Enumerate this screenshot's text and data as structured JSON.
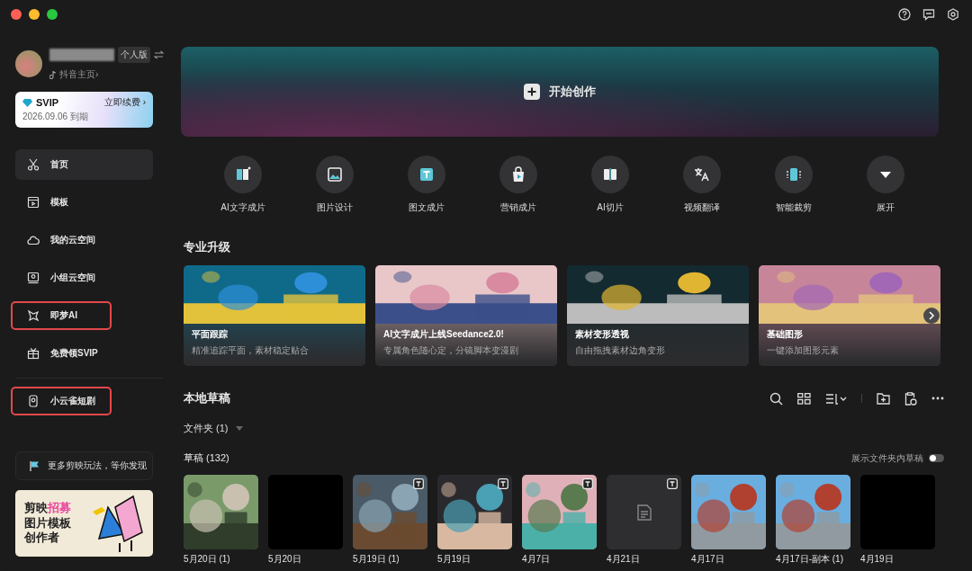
{
  "account": {
    "edition": "个人版",
    "profile_link": "抖音主页›"
  },
  "vip": {
    "badge": "SVIP",
    "renew": "立即续费 ›",
    "expiry": "2026.09.06 到期"
  },
  "nav": [
    {
      "label": "首页",
      "selected": true,
      "highlighted": false
    },
    {
      "label": "模板",
      "selected": false,
      "highlighted": false
    },
    {
      "label": "我的云空间",
      "selected": false,
      "highlighted": false
    },
    {
      "label": "小组云空间",
      "selected": false,
      "highlighted": false
    },
    {
      "label": "即梦AI",
      "selected": false,
      "highlighted": true
    },
    {
      "label": "免费领SVIP",
      "selected": false,
      "highlighted": false
    },
    {
      "label": "小云雀短剧",
      "selected": false,
      "highlighted": true
    }
  ],
  "discover": "更多剪映玩法，等你发现",
  "promo": {
    "line1a": "剪映",
    "line1b": "招募",
    "line2": "图片模板",
    "line3": "创作者"
  },
  "hero": {
    "label": "开始创作"
  },
  "tools": [
    {
      "label": "AI文字成片"
    },
    {
      "label": "图片设计"
    },
    {
      "label": "图文成片"
    },
    {
      "label": "营销成片"
    },
    {
      "label": "AI切片"
    },
    {
      "label": "视频翻译"
    },
    {
      "label": "智能裁剪"
    },
    {
      "label": "展开"
    }
  ],
  "upgrades": {
    "title": "专业升级",
    "cards": [
      {
        "title": "平面跟踪",
        "subtitle": "精准追踪平面，素材稳定贴合"
      },
      {
        "title": "AI文字成片上线Seedance2.0!",
        "subtitle": "专属角色随心定，分镜脚本变漫剧"
      },
      {
        "title": "素材变形透视",
        "subtitle": "自由拖拽素材边角变形"
      },
      {
        "title": "基础图形",
        "subtitle": "一键添加图形元素"
      }
    ]
  },
  "drafts": {
    "title": "本地草稿",
    "folders": "文件夹 (1)",
    "count": "草稿 (132)",
    "show_folder_drafts": {
      "label": "展示文件夹内草稿",
      "on": false
    },
    "items": [
      {
        "label": "5月20日 (1)",
        "kind": "picture",
        "template": false
      },
      {
        "label": "5月20日",
        "kind": "blank",
        "template": false
      },
      {
        "label": "5月19日 (1)",
        "kind": "picture",
        "template": true
      },
      {
        "label": "5月19日",
        "kind": "picture",
        "template": true
      },
      {
        "label": "4月7日",
        "kind": "picture",
        "template": true
      },
      {
        "label": "4月21日",
        "kind": "document",
        "template": true
      },
      {
        "label": "4月17日",
        "kind": "picture",
        "template": false
      },
      {
        "label": "4月17日-副本 (1)",
        "kind": "picture",
        "template": false
      },
      {
        "label": "4月19日",
        "kind": "blank",
        "template": false
      }
    ]
  }
}
